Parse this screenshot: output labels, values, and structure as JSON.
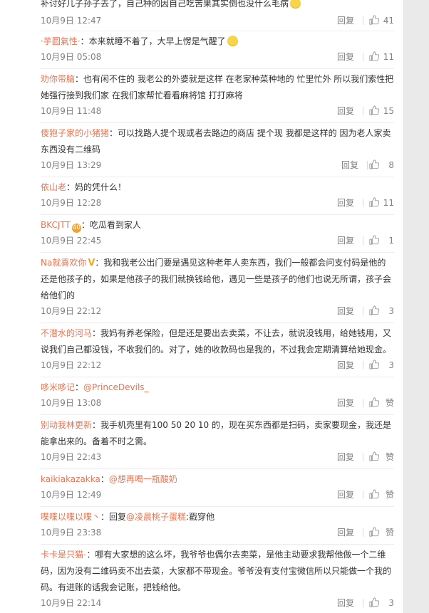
{
  "comments": [
    {
      "user": "",
      "body": "补讨好儿子孙子去了，自己种的因自己吃苦果其实倒也没什么毛病",
      "emoji": true,
      "time": "10月9日 12:47",
      "reply": "回复",
      "likes": "41"
    },
    {
      "user": "·芋圆氣性·",
      "body": "：本来就睡不着了，大早上愣是气醒了",
      "emoji": true,
      "time": "10月9日 05:08",
      "reply": "回复",
      "likes": "11"
    },
    {
      "user": "劝你带脑",
      "body": "：也有闲不住的 我老公的外婆就是这样 在老家种菜种地的 忙里忙外 所以我们索性把她强行接到我们家 在我们家帮忙看看麻将馆 打打麻将",
      "time": "10月9日 11:48",
      "reply": "回复",
      "likes": "15"
    },
    {
      "user": "傻狍子家的小猪猪",
      "body": "：可以找路人提个现或者去路边的商店 提个现 我都是这样的 因为老人家卖东西没有二维码",
      "time": "10月9日 13:29",
      "reply": "回复",
      "likes": "8"
    },
    {
      "user": "依山老",
      "body": "：妈的凭什么！",
      "time": "10月9日 12:28",
      "reply": "回复",
      "likes": "11"
    },
    {
      "user": "BKCJTT",
      "badge": "40",
      "body": "：吃瓜看到家人",
      "time": "10月9日 22:45",
      "reply": "回复",
      "likes": "1"
    },
    {
      "user": "Na就喜欢你",
      "vip": "V",
      "body": "：我和我老公出门要是遇见这种老年人卖东西，我们一般都会问支付码是他的还是他孩子的，如果是他孩子的我们就换钱给他，遇见一些是孩子的他们也说无所谓，孩子会给他们的",
      "time": "10月9日 22:12",
      "reply": "回复",
      "likes": "3"
    },
    {
      "user": "不潜水的河马",
      "body": "：我妈有养老保险，但是还是要出去卖菜，不让去，就说没钱用，给她钱用，又说我们自己都没钱，不收我们的。对了，她的收款码也是我的，不过我会定期清算给她现金。",
      "time": "10月9日 22:12",
      "reply": "回复",
      "likes": "3"
    },
    {
      "user": "哆米哆记",
      "body": "：",
      "mention": "@PrinceDevils_",
      "time": "10月9日 13:08",
      "reply": "回复",
      "likes": "赞"
    },
    {
      "user": "别动我林更新",
      "body": "：我手机壳里有100 50 20 10 的，现在买东西都是扫码，卖家要现金，我还是能拿出来的。备着不时之需。",
      "time": "10月9日 22:43",
      "reply": "回复",
      "likes": "赞"
    },
    {
      "user": "kaikiakazakka",
      "body": "：",
      "mention": "@想再喝一瓶酸奶",
      "time": "10月9日 12:49",
      "reply": "回复",
      "likes": "赞"
    },
    {
      "user": "喋喋以喋以喋丶",
      "body": "：回复",
      "mention": "@凌晨桃子蛋糕",
      "tail": ":戳穿他",
      "time": "10月9日 23:38",
      "reply": "回复",
      "likes": "赞"
    },
    {
      "user": "卡卡是只猫-",
      "body": "：哪有大家想的这么坏，我爷爷也偶尔去卖菜，是他主动要求我帮他做一个二维码，因为没有二维码卖不出去菜，大家都不带现金。爷爷没有支付宝微信所以只能做一个我的码。有进账的话我会记账，把钱给他。",
      "time": "10月9日 22:14",
      "reply": "回复",
      "likes": "3"
    }
  ],
  "colors": {
    "username": "#eb7350",
    "text": "#333333",
    "meta": "#808080"
  },
  "icons": {
    "like": "thumbs-up-icon",
    "badge": "medal-badge-icon",
    "vip": "vip-v-icon",
    "emoji": "emoji-icon"
  }
}
